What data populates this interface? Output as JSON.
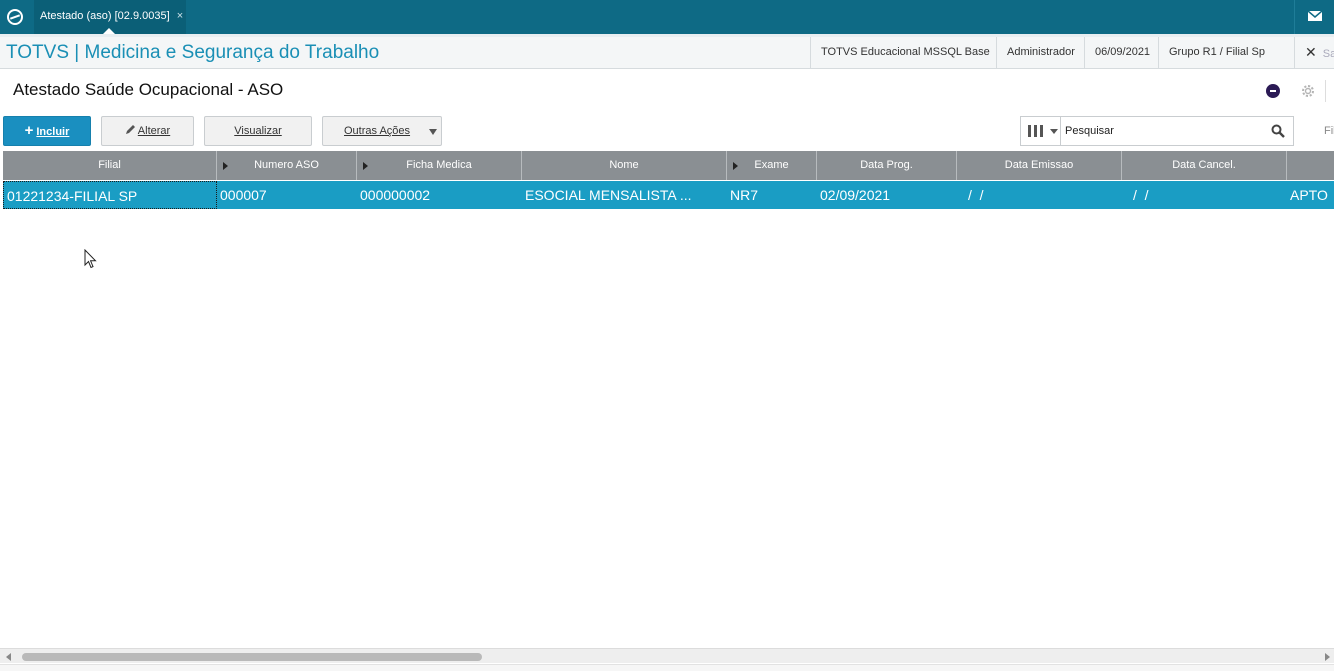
{
  "tab": {
    "label": "Atestado (aso) [02.9.0035]",
    "close": "×"
  },
  "app": {
    "title": "TOTVS | Medicina e Segurança do Trabalho",
    "environment": "TOTVS Educacional MSSQL Base",
    "user": "Administrador",
    "date": "06/09/2021",
    "branch": "Grupo R1 / Filial Sp",
    "exit_label": "Sair"
  },
  "page": {
    "title": "Atestado Saúde Ocupacional - ASO"
  },
  "toolbar": {
    "include": "Incluir",
    "alter": "Alterar",
    "view": "Visualizar",
    "other": "Outras Ações"
  },
  "search": {
    "placeholder": "Pesquisar"
  },
  "filter_label": "Filtrar",
  "grid": {
    "columns": [
      "Filial",
      "Numero ASO",
      "Ficha Medica",
      "Nome",
      "Exame",
      "Data Prog.",
      "Data Emissao",
      "Data Cancel.",
      ""
    ],
    "rows": [
      [
        "01221234-FILIAL SP",
        "000007",
        "000000002",
        "ESOCIAL MENSALISTA ...",
        "NR7",
        "02/09/2021",
        "/  /",
        "/  /",
        "APTO"
      ]
    ]
  },
  "colors": {
    "topbar": "#0e6a85",
    "accent": "#1a8fb5",
    "selected_row": "#1a9dc4",
    "header_bg": "#8a8f93"
  }
}
